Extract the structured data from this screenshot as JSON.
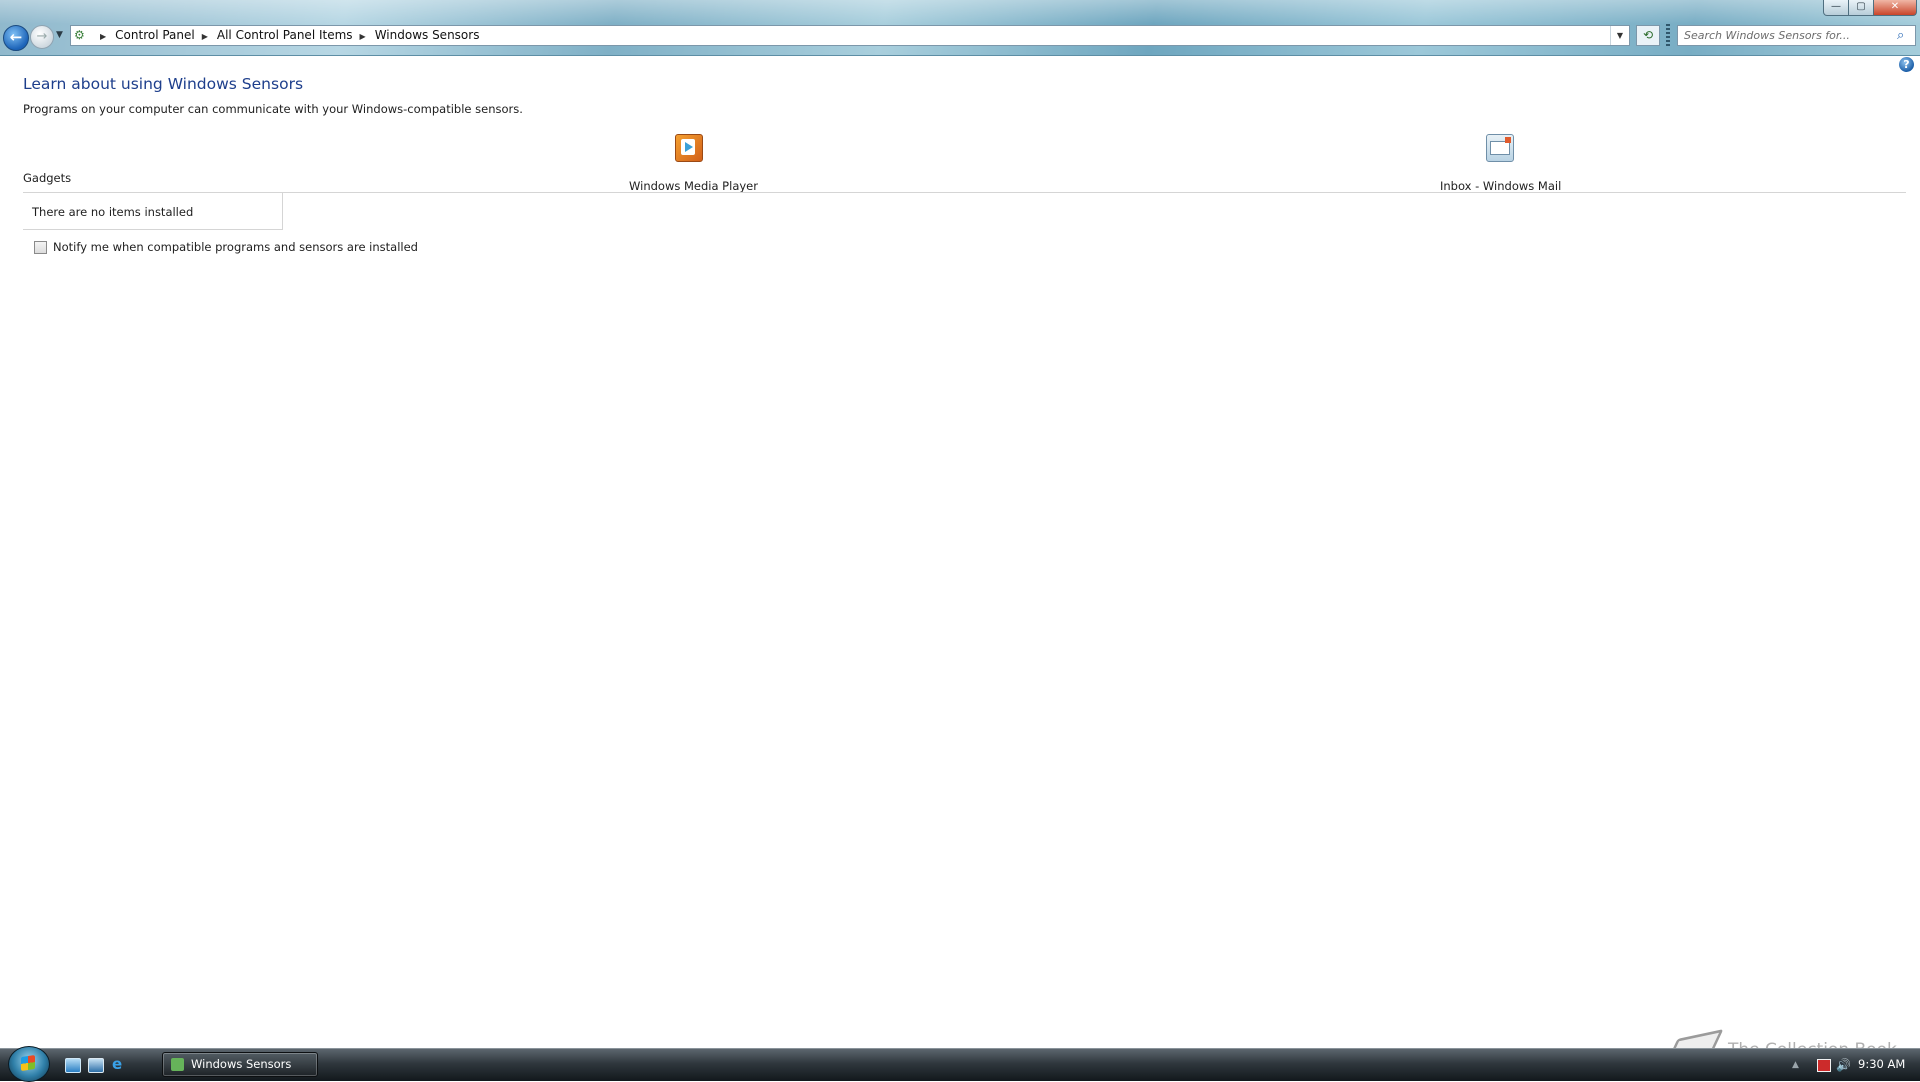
{
  "window": {
    "minimize_glyph": "—",
    "maximize_glyph": "▢",
    "close_glyph": "✕"
  },
  "nav": {
    "back_glyph": "←",
    "forward_glyph": "→",
    "history_glyph": "▼",
    "breadcrumbs": [
      "Control Panel",
      "All Control Panel Items",
      "Windows Sensors"
    ],
    "crumb_separator": "▶",
    "address_dropdown_glyph": "▼",
    "refresh_glyph": "⟲",
    "search_placeholder": "Search Windows Sensors for..."
  },
  "content": {
    "help_glyph": "?",
    "title": "Learn about using Windows Sensors",
    "description": "Programs on your computer can communicate with your Windows-compatible sensors.",
    "programs": [
      {
        "label": "Windows Media Player",
        "icon": "windows-media-player-icon"
      },
      {
        "label": "Inbox - Windows Mail",
        "icon": "windows-mail-icon"
      }
    ],
    "gadgets_label": "Gadgets",
    "no_items": "There are no items installed",
    "notify_label": "Notify me when compatible programs and sensors are installed",
    "notify_checked": false
  },
  "taskbar": {
    "quicklaunch": [
      "show-desktop-icon",
      "switch-windows-icon",
      "internet-explorer-icon"
    ],
    "ie_glyph": "e",
    "task_button": "Windows Sensors",
    "tray_up_glyph": "▲",
    "volume_glyph": "🔊",
    "clock": "9:30 AM"
  },
  "watermark": "The Collection Book",
  "colors": {
    "title_blue": "#1e3f8c",
    "link_blue": "#2a6ab6"
  }
}
